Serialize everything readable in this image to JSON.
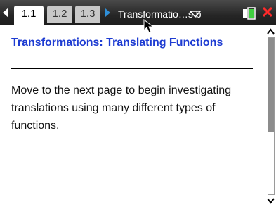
{
  "tabs": [
    {
      "label": "1.1",
      "active": true
    },
    {
      "label": "1.2",
      "active": false
    },
    {
      "label": "1.3",
      "active": false
    }
  ],
  "document_title": "Transformatio…s b",
  "heading": "Transformations: Translating Functions",
  "body": "Move to the next page to begin investigating translations using many different types of functions.",
  "scrollbar": {
    "thumb_fraction": 0.6
  },
  "colors": {
    "heading": "#1e3cd2",
    "nav_arrow": "#2f8fd8",
    "close": "#ff2a2a"
  },
  "icons": [
    "nav-left-icon",
    "nav-right-icon",
    "dropdown-icon",
    "battery-icon",
    "close-icon",
    "cursor-icon",
    "scroll-up-icon",
    "scroll-down-icon"
  ]
}
